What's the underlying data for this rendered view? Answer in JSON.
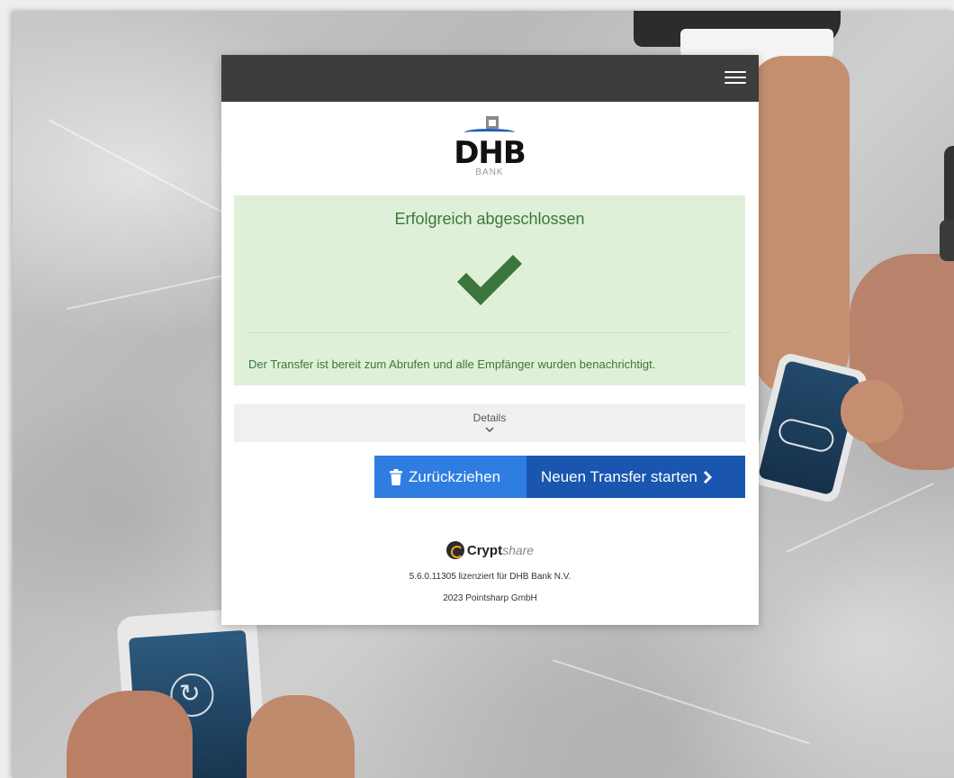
{
  "header": {
    "menu_icon": "hamburger-menu-icon"
  },
  "logo": {
    "name": "DHB",
    "sub": "BANK"
  },
  "status": {
    "title": "Erfolgreich abgeschlossen",
    "icon": "checkmark-icon",
    "message": "Der Transfer ist bereit zum Abrufen und alle Empfänger wurden benachrichtigt.",
    "color": "#3c763d",
    "background": "#dff0d8"
  },
  "details": {
    "label": "Details",
    "icon": "chevron-down-icon"
  },
  "actions": {
    "withdraw_label": "Zurückziehen",
    "withdraw_icon": "trash-icon",
    "new_transfer_label": "Neuen Transfer starten",
    "new_transfer_icon": "chevron-right-icon",
    "withdraw_color": "#2f7de1",
    "new_transfer_color": "#1a56b0"
  },
  "footer": {
    "brand_bold": "Crypt",
    "brand_light": "share",
    "license": "5.6.0.11305 lizenziert für DHB Bank N.V.",
    "copyright": "2023 Pointsharp GmbH"
  }
}
